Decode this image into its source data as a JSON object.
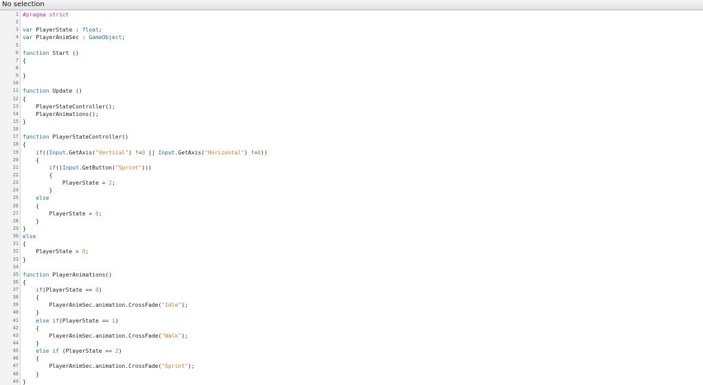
{
  "status_bar": {
    "selection_text": "No selection"
  },
  "colors": {
    "keyword": "#1b6fa8",
    "pragma": "#c02ac0",
    "string": "#d97a10",
    "number": "#d97a10",
    "plain": "#222222",
    "gutter_bg": "#f3f3f3",
    "line_number": "#6e6e6e"
  },
  "editor": {
    "lines": [
      {
        "n": "1",
        "tokens": [
          {
            "t": "#pragma strict",
            "c": "pragma"
          }
        ]
      },
      {
        "n": "2",
        "tokens": []
      },
      {
        "n": "3",
        "tokens": [
          {
            "t": "var",
            "c": "keyword"
          },
          {
            "t": " PlayerState : ",
            "c": "plain"
          },
          {
            "t": "float",
            "c": "type"
          },
          {
            "t": ";",
            "c": "plain"
          }
        ]
      },
      {
        "n": "4",
        "tokens": [
          {
            "t": "var",
            "c": "keyword"
          },
          {
            "t": " PlayerAnimSec : ",
            "c": "plain"
          },
          {
            "t": "GameObject",
            "c": "type"
          },
          {
            "t": ";",
            "c": "plain"
          }
        ]
      },
      {
        "n": "5",
        "tokens": []
      },
      {
        "n": "6",
        "tokens": [
          {
            "t": "function",
            "c": "keyword"
          },
          {
            "t": " Start ()",
            "c": "plain"
          }
        ]
      },
      {
        "n": "7",
        "tokens": [
          {
            "t": "{",
            "c": "plain"
          }
        ]
      },
      {
        "n": "8",
        "tokens": []
      },
      {
        "n": "9",
        "tokens": [
          {
            "t": "}",
            "c": "plain"
          }
        ]
      },
      {
        "n": "10",
        "tokens": []
      },
      {
        "n": "11",
        "tokens": [
          {
            "t": "function",
            "c": "keyword"
          },
          {
            "t": " Update ()",
            "c": "plain"
          }
        ]
      },
      {
        "n": "12",
        "tokens": [
          {
            "t": "{",
            "c": "plain"
          }
        ]
      },
      {
        "n": "13",
        "tokens": [
          {
            "t": "    PlayerStateController();",
            "c": "plain"
          }
        ]
      },
      {
        "n": "14",
        "tokens": [
          {
            "t": "    PlayerAnimations();",
            "c": "plain"
          }
        ]
      },
      {
        "n": "15",
        "tokens": [
          {
            "t": "}",
            "c": "plain"
          }
        ]
      },
      {
        "n": "16",
        "tokens": []
      },
      {
        "n": "17",
        "tokens": [
          {
            "t": "function",
            "c": "keyword"
          },
          {
            "t": " PlayerStateController()",
            "c": "plain"
          }
        ]
      },
      {
        "n": "18",
        "tokens": [
          {
            "t": "{",
            "c": "plain"
          }
        ]
      },
      {
        "n": "19",
        "tokens": [
          {
            "t": "    ",
            "c": "plain"
          },
          {
            "t": "if",
            "c": "keyword"
          },
          {
            "t": "((",
            "c": "plain"
          },
          {
            "t": "Input",
            "c": "type"
          },
          {
            "t": ".GetAxis(",
            "c": "plain"
          },
          {
            "t": "\"Vertical\"",
            "c": "string"
          },
          {
            "t": ") !=",
            "c": "plain"
          },
          {
            "t": "0",
            "c": "number"
          },
          {
            "t": " || ",
            "c": "plain"
          },
          {
            "t": "Input",
            "c": "type"
          },
          {
            "t": ".GetAxis(",
            "c": "plain"
          },
          {
            "t": "\"Horizontal\"",
            "c": "string"
          },
          {
            "t": ") !=",
            "c": "plain"
          },
          {
            "t": "0",
            "c": "number"
          },
          {
            "t": "))",
            "c": "plain"
          }
        ]
      },
      {
        "n": "20",
        "tokens": [
          {
            "t": "    {",
            "c": "plain"
          }
        ]
      },
      {
        "n": "21",
        "tokens": [
          {
            "t": "        ",
            "c": "plain"
          },
          {
            "t": "if",
            "c": "keyword"
          },
          {
            "t": "((",
            "c": "plain"
          },
          {
            "t": "Input",
            "c": "type"
          },
          {
            "t": ".GetButton(",
            "c": "plain"
          },
          {
            "t": "\"Sprint\"",
            "c": "string"
          },
          {
            "t": ")))",
            "c": "plain"
          }
        ]
      },
      {
        "n": "22",
        "tokens": [
          {
            "t": "        {",
            "c": "plain"
          }
        ]
      },
      {
        "n": "23",
        "tokens": [
          {
            "t": "            PlayerState = ",
            "c": "plain"
          },
          {
            "t": "2",
            "c": "number"
          },
          {
            "t": ";",
            "c": "plain"
          }
        ]
      },
      {
        "n": "24",
        "tokens": [
          {
            "t": "        }",
            "c": "plain"
          }
        ]
      },
      {
        "n": "25",
        "tokens": [
          {
            "t": "    ",
            "c": "plain"
          },
          {
            "t": "else",
            "c": "keyword"
          }
        ]
      },
      {
        "n": "26",
        "tokens": [
          {
            "t": "    {",
            "c": "plain"
          }
        ]
      },
      {
        "n": "27",
        "tokens": [
          {
            "t": "        PlayerState = ",
            "c": "plain"
          },
          {
            "t": "0",
            "c": "number"
          },
          {
            "t": ";",
            "c": "plain"
          }
        ]
      },
      {
        "n": "28",
        "tokens": [
          {
            "t": "    }",
            "c": "plain"
          }
        ]
      },
      {
        "n": "29",
        "tokens": [
          {
            "t": "}",
            "c": "plain"
          }
        ]
      },
      {
        "n": "30",
        "tokens": [
          {
            "t": "else",
            "c": "keyword"
          }
        ]
      },
      {
        "n": "31",
        "tokens": [
          {
            "t": "{",
            "c": "plain"
          }
        ]
      },
      {
        "n": "32",
        "tokens": [
          {
            "t": "    PlayerState = ",
            "c": "plain"
          },
          {
            "t": "0",
            "c": "number"
          },
          {
            "t": ";",
            "c": "plain"
          }
        ]
      },
      {
        "n": "33",
        "tokens": [
          {
            "t": "}",
            "c": "plain"
          }
        ]
      },
      {
        "n": "34",
        "tokens": []
      },
      {
        "n": "35",
        "tokens": [
          {
            "t": "function",
            "c": "keyword"
          },
          {
            "t": " PlayerAnimations()",
            "c": "plain"
          }
        ]
      },
      {
        "n": "36",
        "tokens": [
          {
            "t": "{",
            "c": "plain"
          }
        ]
      },
      {
        "n": "37",
        "tokens": [
          {
            "t": "    ",
            "c": "plain"
          },
          {
            "t": "if",
            "c": "keyword"
          },
          {
            "t": "(PlayerState == ",
            "c": "plain"
          },
          {
            "t": "0",
            "c": "number"
          },
          {
            "t": ")",
            "c": "plain"
          }
        ]
      },
      {
        "n": "38",
        "tokens": [
          {
            "t": "    {",
            "c": "plain"
          }
        ]
      },
      {
        "n": "39",
        "tokens": [
          {
            "t": "        PlayerAnimSec.animation.CrossFade(",
            "c": "plain"
          },
          {
            "t": "\"Idle\"",
            "c": "string"
          },
          {
            "t": ");",
            "c": "plain"
          }
        ]
      },
      {
        "n": "40",
        "tokens": [
          {
            "t": "    }",
            "c": "plain"
          }
        ]
      },
      {
        "n": "41",
        "tokens": [
          {
            "t": "    ",
            "c": "plain"
          },
          {
            "t": "else if",
            "c": "keyword"
          },
          {
            "t": "(PlayerState == ",
            "c": "plain"
          },
          {
            "t": "1",
            "c": "number"
          },
          {
            "t": ")",
            "c": "plain"
          }
        ]
      },
      {
        "n": "42",
        "tokens": [
          {
            "t": "    {",
            "c": "plain"
          }
        ]
      },
      {
        "n": "43",
        "tokens": [
          {
            "t": "        PlayerAnimSec.animation.CrossFade(",
            "c": "plain"
          },
          {
            "t": "\"Walk\"",
            "c": "string"
          },
          {
            "t": ");",
            "c": "plain"
          }
        ]
      },
      {
        "n": "44",
        "tokens": [
          {
            "t": "    }",
            "c": "plain"
          }
        ]
      },
      {
        "n": "45",
        "tokens": [
          {
            "t": "    ",
            "c": "plain"
          },
          {
            "t": "else if",
            "c": "keyword"
          },
          {
            "t": " (PlayerState == ",
            "c": "plain"
          },
          {
            "t": "2",
            "c": "number"
          },
          {
            "t": ")",
            "c": "plain"
          }
        ]
      },
      {
        "n": "46",
        "tokens": [
          {
            "t": "    {",
            "c": "plain"
          }
        ]
      },
      {
        "n": "47",
        "tokens": [
          {
            "t": "        PlayerAnimSec.animation.CrossFade(",
            "c": "plain"
          },
          {
            "t": "\"Sprint\"",
            "c": "string"
          },
          {
            "t": ");",
            "c": "plain"
          }
        ]
      },
      {
        "n": "48",
        "tokens": [
          {
            "t": "    }",
            "c": "plain"
          }
        ]
      },
      {
        "n": "49",
        "tokens": [
          {
            "t": "}",
            "c": "plain"
          }
        ]
      }
    ]
  }
}
